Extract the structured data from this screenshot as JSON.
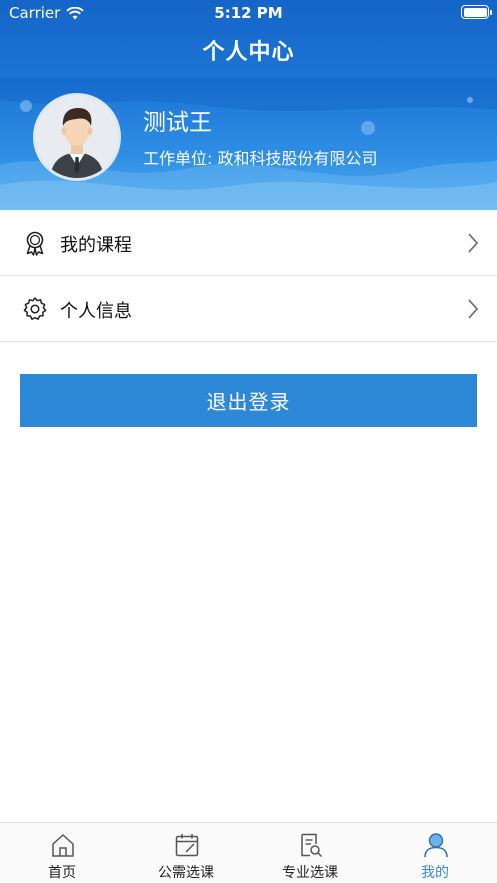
{
  "status_bar": {
    "carrier": "Carrier",
    "time": "5:12 PM"
  },
  "nav": {
    "title": "个人中心"
  },
  "profile": {
    "name": "测试王",
    "org_label": "工作单位: 政和科技股份有限公司"
  },
  "menu": [
    {
      "label": "我的课程",
      "icon": "award-icon"
    },
    {
      "label": "个人信息",
      "icon": "gear-icon"
    }
  ],
  "logout_label": "退出登录",
  "tabs": [
    {
      "label": "首页",
      "icon": "home-icon",
      "active": false
    },
    {
      "label": "公需选课",
      "icon": "calendar-icon",
      "active": false
    },
    {
      "label": "专业选课",
      "icon": "document-search-icon",
      "active": false
    },
    {
      "label": "我的",
      "icon": "user-icon",
      "active": true
    }
  ],
  "colors": {
    "header_blue": "#1d76d6",
    "button_blue": "#2e88d8",
    "active_tab": "#3a8ad8"
  }
}
